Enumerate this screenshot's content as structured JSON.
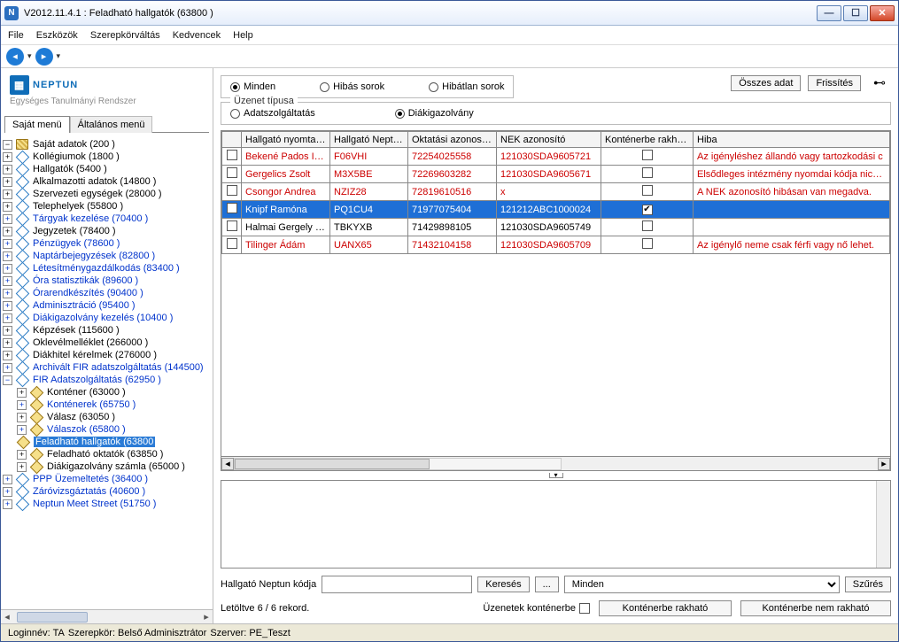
{
  "window": {
    "title": "V2012.11.4.1 : Feladható hallgatók (63800  )"
  },
  "menus": {
    "file": "File",
    "tools": "Eszközök",
    "role": "Szerepkörváltás",
    "fav": "Kedvencek",
    "help": "Help"
  },
  "logo": {
    "brand": "NEPTUN",
    "subtitle": "Egységes Tanulmányi Rendszer"
  },
  "tabs": {
    "own": "Saját menü",
    "general": "Általános menü"
  },
  "tree": {
    "sajat": "Saját adatok (200  )",
    "items": [
      {
        "t": "Kollégiumok (1800  )"
      },
      {
        "t": "Hallgatók (5400  )"
      },
      {
        "t": "Alkalmazotti adatok (14800  )"
      },
      {
        "t": "Szervezeti egységek (28000  )"
      },
      {
        "t": "Telephelyek (55800  )"
      },
      {
        "t": "Tárgyak kezelése (70400  )",
        "link": true
      },
      {
        "t": "Jegyzetek (78400  )"
      },
      {
        "t": "Pénzügyek (78600  )",
        "link": true
      },
      {
        "t": "Naptárbejegyzések (82800  )",
        "link": true
      },
      {
        "t": "Létesítménygazdálkodás (83400  )",
        "link": true
      },
      {
        "t": "Óra statisztikák (89600  )",
        "link": true
      },
      {
        "t": "Órarendkészítés (90400  )",
        "link": true
      },
      {
        "t": "Adminisztráció (95400  )",
        "link": true
      },
      {
        "t": "Diákigazolvány kezelés (10400  )",
        "link": true
      },
      {
        "t": "Képzések (115600  )"
      },
      {
        "t": "Oklevélmelléklet (266000  )"
      },
      {
        "t": "Diákhitel kérelmek (276000  )"
      },
      {
        "t": "Archivált FIR adatszolgáltatás (144500)",
        "link": true
      },
      {
        "t": "FIR Adatszolgáltatás (62950  )",
        "link": true,
        "open": true
      }
    ],
    "fir_children": [
      {
        "t": "Konténer (63000  )"
      },
      {
        "t": "Konténerek (65750  )",
        "link": true
      },
      {
        "t": "Válasz (63050  )"
      },
      {
        "t": "Válaszok (65800  )",
        "link": true
      },
      {
        "t": "Feladható hallgatók (63800",
        "link": true,
        "sel": true
      },
      {
        "t": "Feladható oktatók (63850  )"
      },
      {
        "t": "Diákigazolvány számla (65000  )"
      }
    ],
    "tail": [
      {
        "t": "PPP Üzemeltetés (36400  )",
        "link": true
      },
      {
        "t": "Záróvizsgáztatás (40600  )",
        "link": true
      },
      {
        "t": "Neptun Meet Street (51750  )",
        "link": true
      }
    ]
  },
  "filters": {
    "all": "Minden",
    "err": "Hibás sorok",
    "ok": "Hibátlan sorok",
    "btn_all": "Összes adat",
    "btn_refresh": "Frissítés",
    "group_title": "Üzenet típusa",
    "r1": "Adatszolgáltatás",
    "r2": "Diákigazolvány"
  },
  "table": {
    "headers": {
      "chk": "",
      "nyomt": "Hallgató nyomtatá...",
      "nept": "Hallgató Nept...",
      "okt": "Oktatási azonosító",
      "nek": "NEK azonosító",
      "kon": "Konténerbe rakható",
      "hiba": "Hiba"
    },
    "rows": [
      {
        "nyomt": "Bekené Pados Ivett",
        "nept": "F06VHI",
        "okt": "72254025558",
        "nek": "121030SDA9605721",
        "chk": false,
        "hiba": "Az igényléshez állandó vagy tartozkodási c",
        "red": true
      },
      {
        "nyomt": "Gergelics Zsolt",
        "nept": "M3X5BE",
        "okt": "72269603282",
        "nek": "121030SDA9605671",
        "chk": false,
        "hiba": "Elsődleges intézmény nyomdai kódja nics m",
        "red": true
      },
      {
        "nyomt": "Csongor Andrea",
        "nept": "NZIZ28",
        "okt": "72819610516",
        "nek": "x",
        "chk": false,
        "hiba": "A NEK azonosító hibásan van megadva.",
        "red": true
      },
      {
        "nyomt": "Knipf Ramóna",
        "nept": "PQ1CU4",
        "okt": "71977075404",
        "nek": "121212ABC1000024",
        "chk": true,
        "hiba": "",
        "sel": true
      },
      {
        "nyomt": "Halmai Gergely Gáb",
        "nept": "TBKYXB",
        "okt": "71429898105",
        "nek": "121030SDA9605749",
        "chk": false,
        "hiba": ""
      },
      {
        "nyomt": "Tilinger Ádám",
        "nept": "UANX65",
        "okt": "71432104158",
        "nek": "121030SDA9605709",
        "chk": false,
        "hiba": "Az igénylő neme csak férfi vagy nő lehet.",
        "red": true
      }
    ]
  },
  "search": {
    "label": "Hallgató Neptun kódja",
    "btn": "Keresés",
    "dots": "...",
    "combo": "Minden",
    "filter": "Szűrés"
  },
  "footer": {
    "records": "Letöltve 6 / 6 rekord.",
    "msglabel": "Üzenetek konténerbe",
    "btn_add": "Konténerbe rakható",
    "btn_rem": "Konténerbe nem rakható"
  },
  "status": {
    "login": "Loginnév: TA",
    "role": "Szerepkör: Belső Adminisztrátor",
    "server": "Szerver: PE_Teszt"
  }
}
